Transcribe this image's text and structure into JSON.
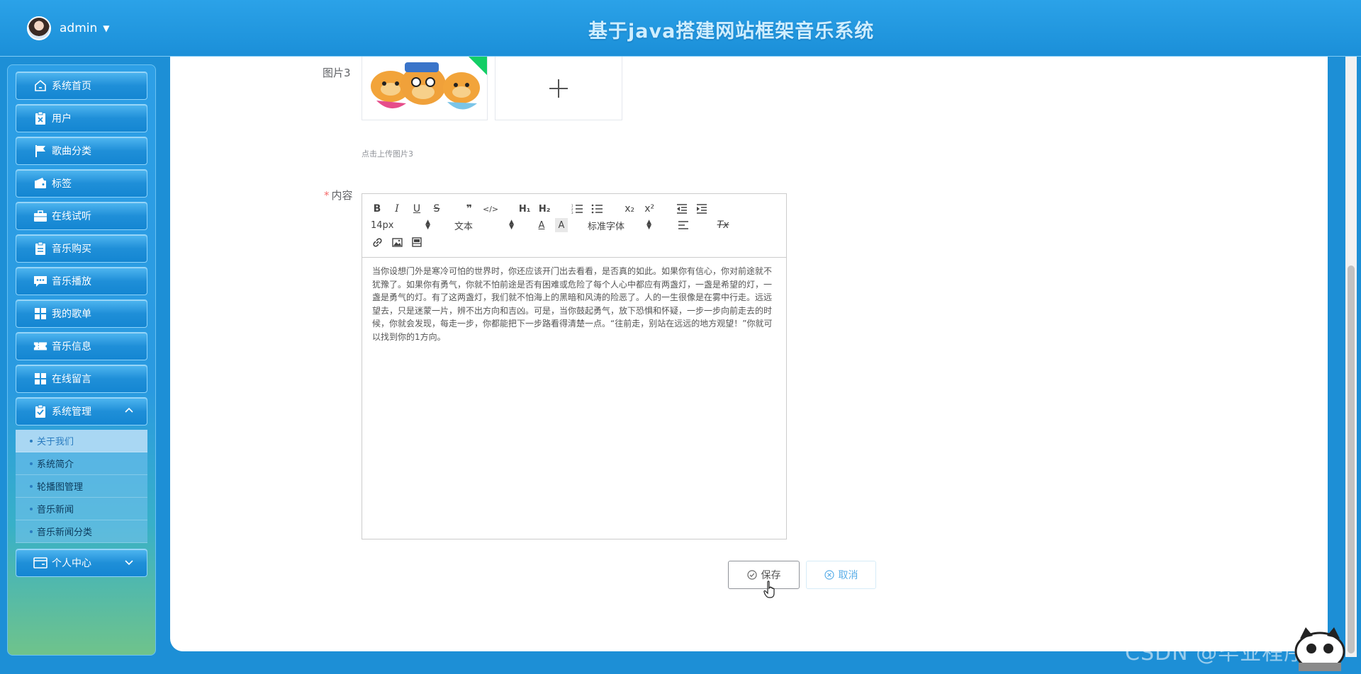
{
  "header": {
    "username": "admin",
    "title": "基于java搭建网站框架音乐系统"
  },
  "sidebar": {
    "items": [
      {
        "label": "系统首页",
        "icon": "home-icon"
      },
      {
        "label": "用户",
        "icon": "user-clipboard-icon"
      },
      {
        "label": "歌曲分类",
        "icon": "flag-icon"
      },
      {
        "label": "标签",
        "icon": "wallet-icon"
      },
      {
        "label": "在线试听",
        "icon": "briefcase-icon"
      },
      {
        "label": "音乐购买",
        "icon": "clipboard-icon"
      },
      {
        "label": "音乐播放",
        "icon": "chat-icon"
      },
      {
        "label": "我的歌单",
        "icon": "grid-icon"
      },
      {
        "label": "音乐信息",
        "icon": "ticket-icon"
      },
      {
        "label": "在线留言",
        "icon": "grid-icon"
      },
      {
        "label": "系统管理",
        "icon": "check-clipboard-icon"
      }
    ],
    "submenu": [
      {
        "label": "关于我们",
        "active": true
      },
      {
        "label": "系统简介"
      },
      {
        "label": "轮播图管理"
      },
      {
        "label": "音乐新闻"
      },
      {
        "label": "音乐新闻分类"
      }
    ],
    "personal": {
      "label": "个人中心",
      "icon": "card-icon"
    }
  },
  "form": {
    "image3_label": "图片3",
    "image3_hint": "点击上传图片3",
    "content_label": "内容",
    "required_mark": "*"
  },
  "editor": {
    "size_select": "14px",
    "header_select": "文本",
    "font_select": "标准字体",
    "content": "当你设想门外是寒冷可怕的世界时，你还应该开门出去看看，是否真的如此。如果你有信心，你对前途就不犹豫了。如果你有勇气，你就不怕前途是否有困难或危险了每个人心中都应有两盏灯，一盏是希望的灯，一盏是勇气的灯。有了这两盏灯，我们就不怕海上的黑暗和风涛的险恶了。人的一生很像是在雾中行走。远远望去，只是迷蒙一片，辨不出方向和吉凶。可是，当你鼓起勇气，放下恐惧和怀疑，一步一步向前走去的时候，你就会发现，每走一步，你都能把下一步路看得清楚一点。“往前走，别站在远远的地方观望！”你就可以找到你的1方向。"
  },
  "buttons": {
    "save": "保存",
    "cancel": "取消"
  },
  "watermark": "CSDN @毕业程序员",
  "colors": {
    "header_bg": "#1b8fd8",
    "accent": "#409eff",
    "required": "#f56c6c",
    "upload_status": "#13ce66"
  }
}
